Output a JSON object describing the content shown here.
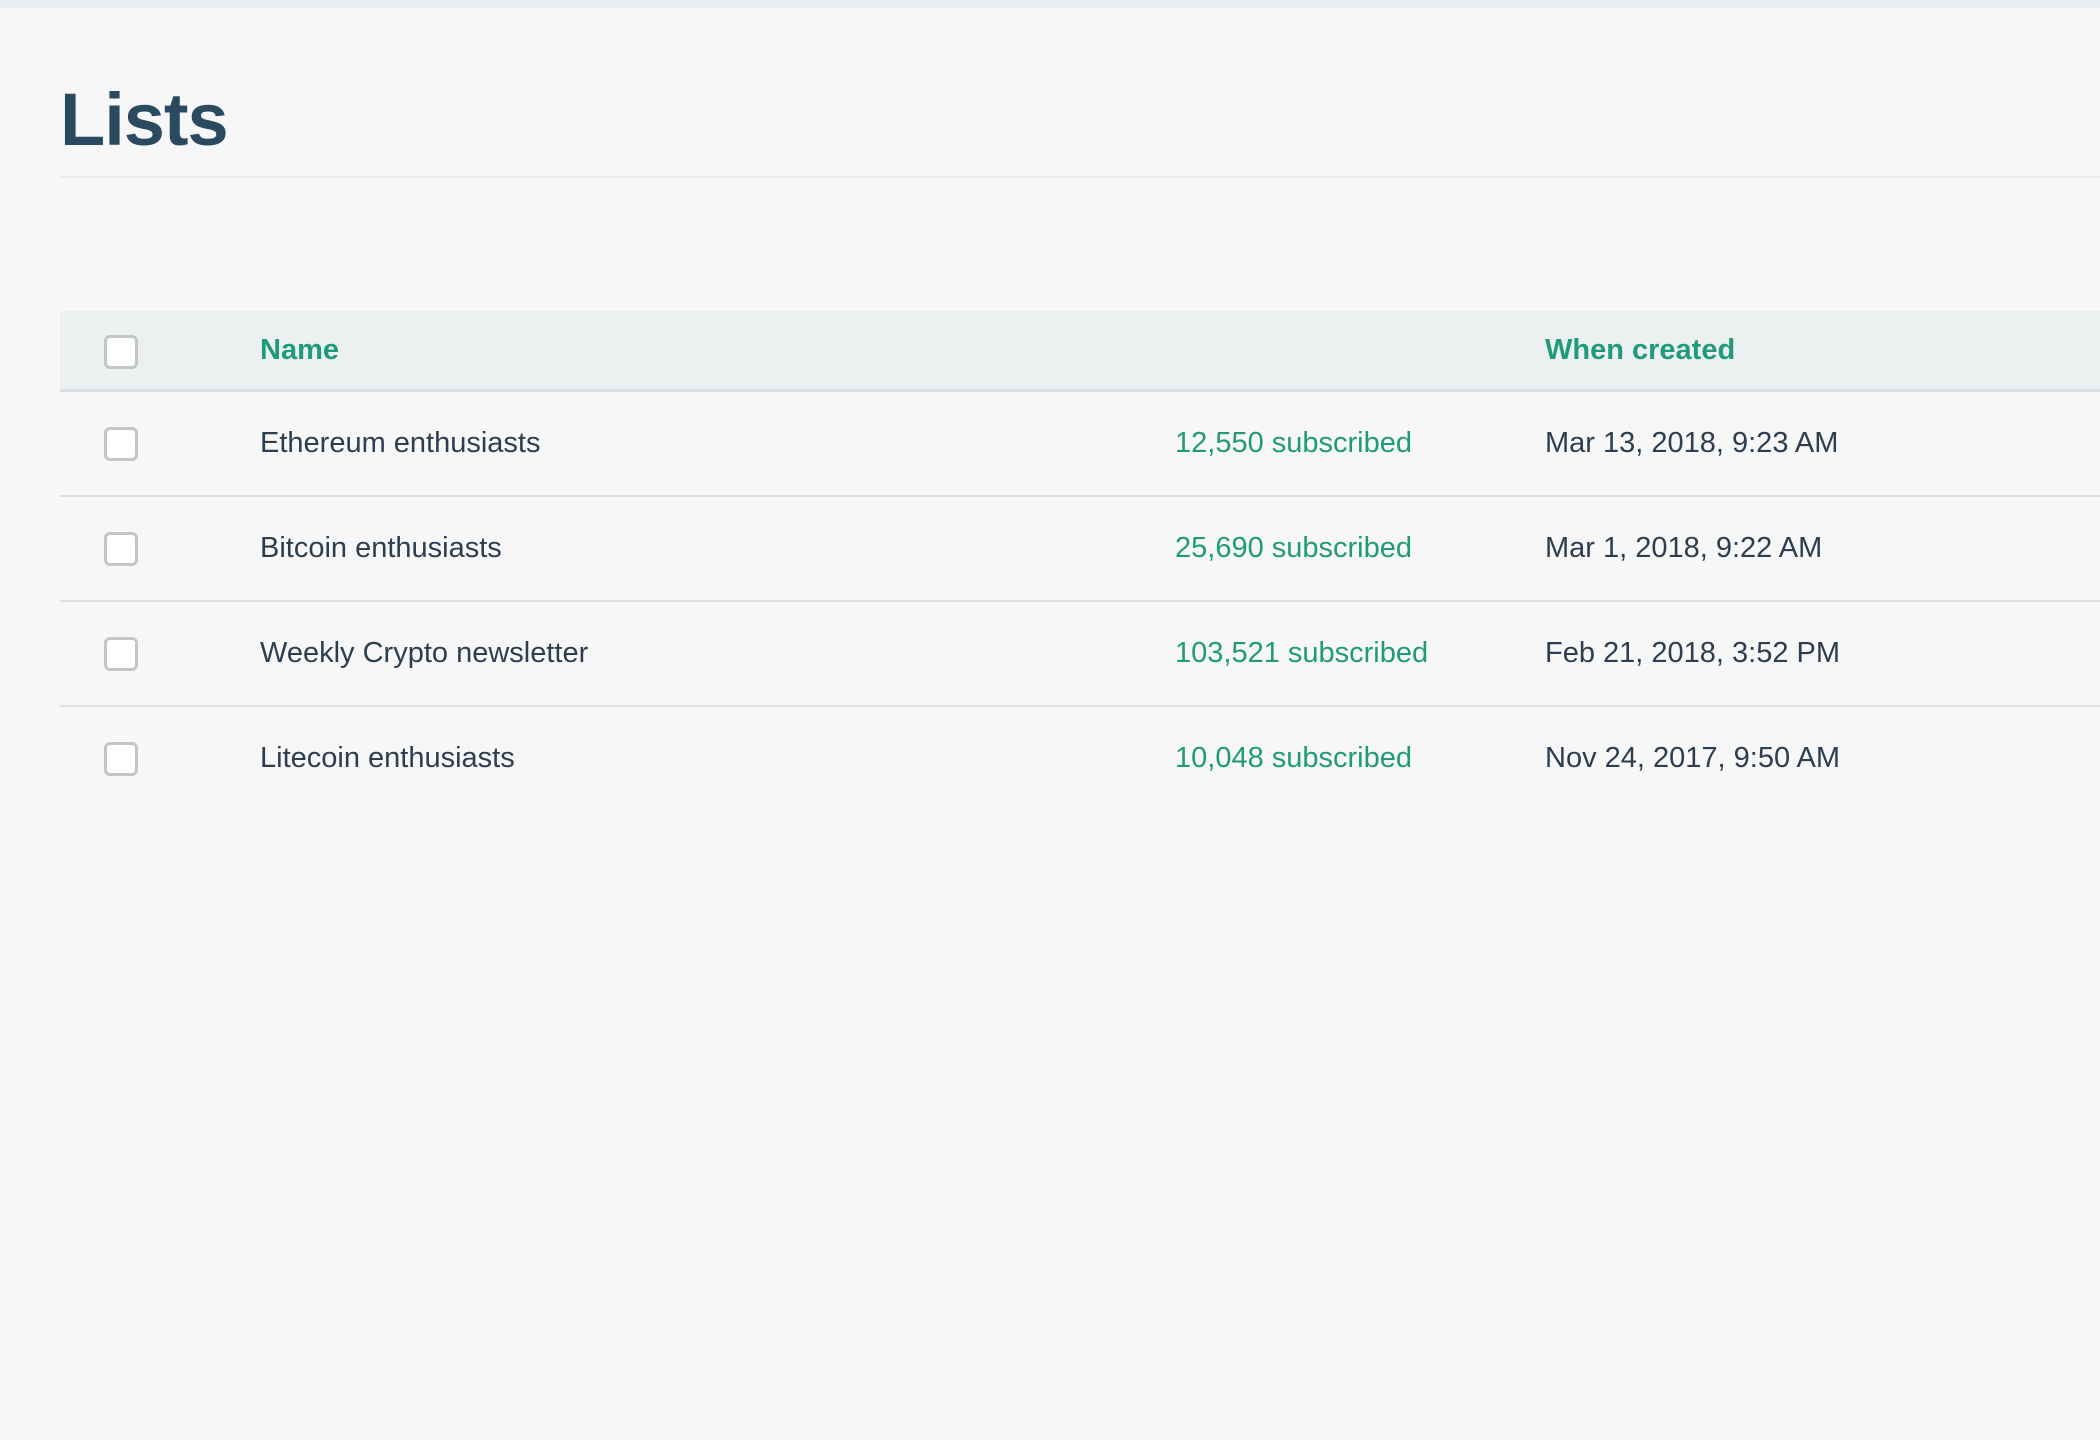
{
  "page": {
    "title": "Lists"
  },
  "table": {
    "headers": {
      "name": "Name",
      "subscribers": "",
      "created": "When created"
    },
    "rows": [
      {
        "name": "Ethereum enthusiasts",
        "subscribed": "12,550 subscribed",
        "created": "Mar 13, 2018, 9:23 AM",
        "checked": false
      },
      {
        "name": "Bitcoin enthusiasts",
        "subscribed": "25,690 subscribed",
        "created": "Mar 1, 2018, 9:22 AM",
        "checked": false
      },
      {
        "name": "Weekly Crypto newsletter",
        "subscribed": "103,521 subscribed",
        "created": "Feb 21, 2018, 3:52 PM",
        "checked": false
      },
      {
        "name": "Litecoin enthusiasts",
        "subscribed": "10,048 subscribed",
        "created": "Nov 24, 2017, 9:50 AM",
        "checked": false
      }
    ]
  },
  "colors": {
    "accent": "#1f9b77",
    "title": "#2a4a60",
    "text": "#2c3e50",
    "background": "#f7f7f7",
    "header_background": "#edf0f1",
    "checkbox_border": "#c2c6c9"
  }
}
